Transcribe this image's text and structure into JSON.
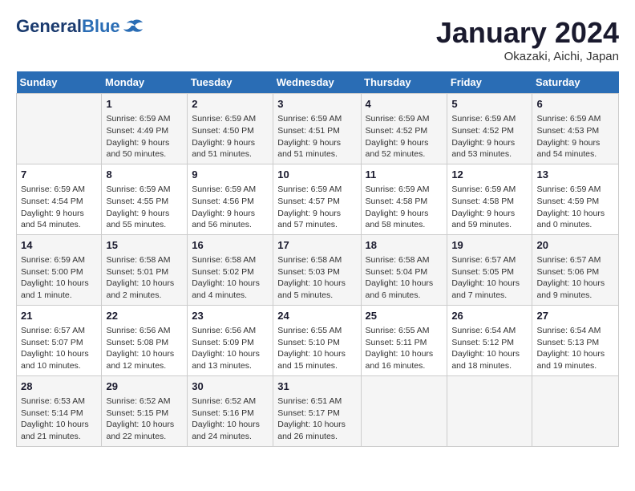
{
  "header": {
    "logo_general": "General",
    "logo_blue": "Blue",
    "month_title": "January 2024",
    "location": "Okazaki, Aichi, Japan"
  },
  "days_of_week": [
    "Sunday",
    "Monday",
    "Tuesday",
    "Wednesday",
    "Thursday",
    "Friday",
    "Saturday"
  ],
  "weeks": [
    [
      {
        "num": "",
        "info": ""
      },
      {
        "num": "1",
        "info": "Sunrise: 6:59 AM\nSunset: 4:49 PM\nDaylight: 9 hours\nand 50 minutes."
      },
      {
        "num": "2",
        "info": "Sunrise: 6:59 AM\nSunset: 4:50 PM\nDaylight: 9 hours\nand 51 minutes."
      },
      {
        "num": "3",
        "info": "Sunrise: 6:59 AM\nSunset: 4:51 PM\nDaylight: 9 hours\nand 51 minutes."
      },
      {
        "num": "4",
        "info": "Sunrise: 6:59 AM\nSunset: 4:52 PM\nDaylight: 9 hours\nand 52 minutes."
      },
      {
        "num": "5",
        "info": "Sunrise: 6:59 AM\nSunset: 4:52 PM\nDaylight: 9 hours\nand 53 minutes."
      },
      {
        "num": "6",
        "info": "Sunrise: 6:59 AM\nSunset: 4:53 PM\nDaylight: 9 hours\nand 54 minutes."
      }
    ],
    [
      {
        "num": "7",
        "info": "Sunrise: 6:59 AM\nSunset: 4:54 PM\nDaylight: 9 hours\nand 54 minutes."
      },
      {
        "num": "8",
        "info": "Sunrise: 6:59 AM\nSunset: 4:55 PM\nDaylight: 9 hours\nand 55 minutes."
      },
      {
        "num": "9",
        "info": "Sunrise: 6:59 AM\nSunset: 4:56 PM\nDaylight: 9 hours\nand 56 minutes."
      },
      {
        "num": "10",
        "info": "Sunrise: 6:59 AM\nSunset: 4:57 PM\nDaylight: 9 hours\nand 57 minutes."
      },
      {
        "num": "11",
        "info": "Sunrise: 6:59 AM\nSunset: 4:58 PM\nDaylight: 9 hours\nand 58 minutes."
      },
      {
        "num": "12",
        "info": "Sunrise: 6:59 AM\nSunset: 4:58 PM\nDaylight: 9 hours\nand 59 minutes."
      },
      {
        "num": "13",
        "info": "Sunrise: 6:59 AM\nSunset: 4:59 PM\nDaylight: 10 hours\nand 0 minutes."
      }
    ],
    [
      {
        "num": "14",
        "info": "Sunrise: 6:59 AM\nSunset: 5:00 PM\nDaylight: 10 hours\nand 1 minute."
      },
      {
        "num": "15",
        "info": "Sunrise: 6:58 AM\nSunset: 5:01 PM\nDaylight: 10 hours\nand 2 minutes."
      },
      {
        "num": "16",
        "info": "Sunrise: 6:58 AM\nSunset: 5:02 PM\nDaylight: 10 hours\nand 4 minutes."
      },
      {
        "num": "17",
        "info": "Sunrise: 6:58 AM\nSunset: 5:03 PM\nDaylight: 10 hours\nand 5 minutes."
      },
      {
        "num": "18",
        "info": "Sunrise: 6:58 AM\nSunset: 5:04 PM\nDaylight: 10 hours\nand 6 minutes."
      },
      {
        "num": "19",
        "info": "Sunrise: 6:57 AM\nSunset: 5:05 PM\nDaylight: 10 hours\nand 7 minutes."
      },
      {
        "num": "20",
        "info": "Sunrise: 6:57 AM\nSunset: 5:06 PM\nDaylight: 10 hours\nand 9 minutes."
      }
    ],
    [
      {
        "num": "21",
        "info": "Sunrise: 6:57 AM\nSunset: 5:07 PM\nDaylight: 10 hours\nand 10 minutes."
      },
      {
        "num": "22",
        "info": "Sunrise: 6:56 AM\nSunset: 5:08 PM\nDaylight: 10 hours\nand 12 minutes."
      },
      {
        "num": "23",
        "info": "Sunrise: 6:56 AM\nSunset: 5:09 PM\nDaylight: 10 hours\nand 13 minutes."
      },
      {
        "num": "24",
        "info": "Sunrise: 6:55 AM\nSunset: 5:10 PM\nDaylight: 10 hours\nand 15 minutes."
      },
      {
        "num": "25",
        "info": "Sunrise: 6:55 AM\nSunset: 5:11 PM\nDaylight: 10 hours\nand 16 minutes."
      },
      {
        "num": "26",
        "info": "Sunrise: 6:54 AM\nSunset: 5:12 PM\nDaylight: 10 hours\nand 18 minutes."
      },
      {
        "num": "27",
        "info": "Sunrise: 6:54 AM\nSunset: 5:13 PM\nDaylight: 10 hours\nand 19 minutes."
      }
    ],
    [
      {
        "num": "28",
        "info": "Sunrise: 6:53 AM\nSunset: 5:14 PM\nDaylight: 10 hours\nand 21 minutes."
      },
      {
        "num": "29",
        "info": "Sunrise: 6:52 AM\nSunset: 5:15 PM\nDaylight: 10 hours\nand 22 minutes."
      },
      {
        "num": "30",
        "info": "Sunrise: 6:52 AM\nSunset: 5:16 PM\nDaylight: 10 hours\nand 24 minutes."
      },
      {
        "num": "31",
        "info": "Sunrise: 6:51 AM\nSunset: 5:17 PM\nDaylight: 10 hours\nand 26 minutes."
      },
      {
        "num": "",
        "info": ""
      },
      {
        "num": "",
        "info": ""
      },
      {
        "num": "",
        "info": ""
      }
    ]
  ]
}
